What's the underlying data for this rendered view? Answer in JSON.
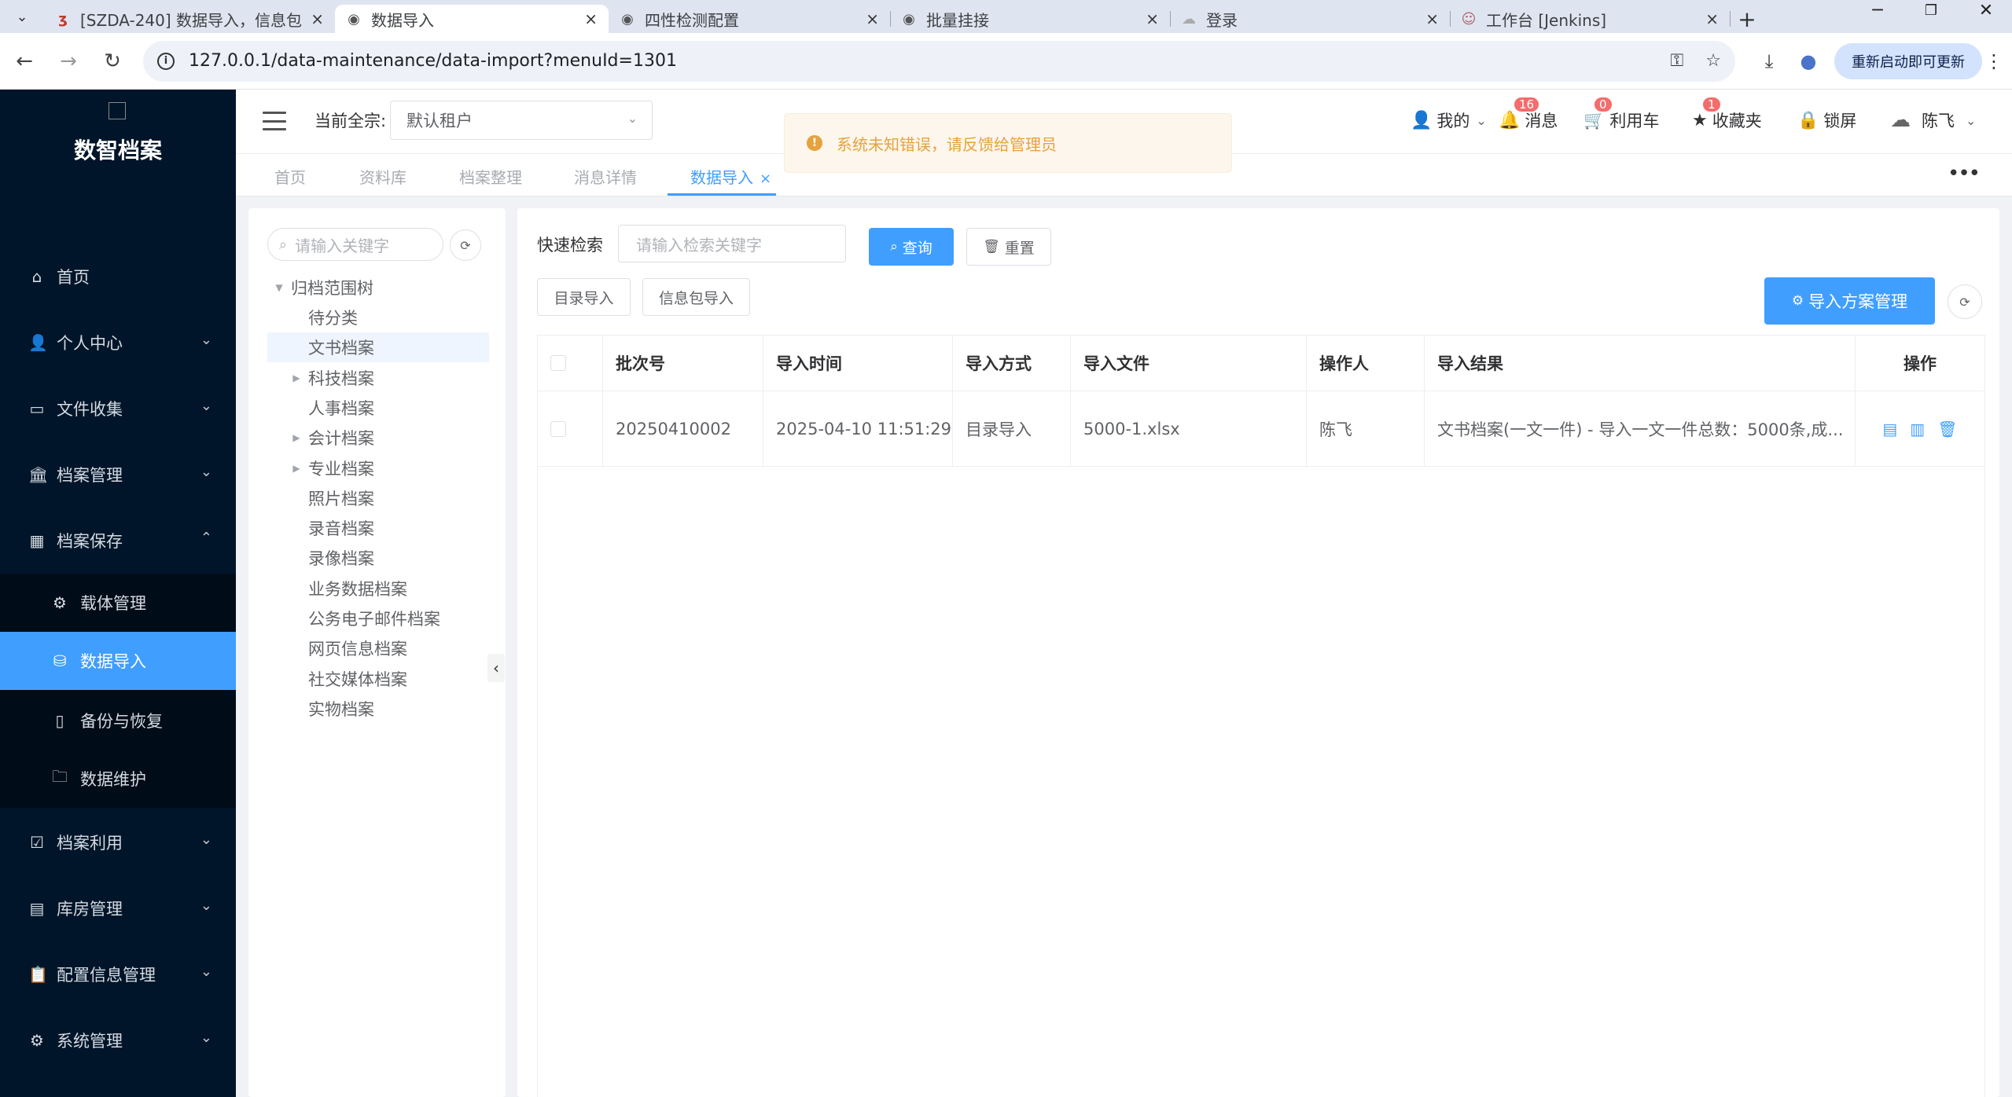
{
  "browser": {
    "tabs": [
      {
        "title": "[SZDA-240] 数据导入，信息包",
        "icon": "jira-icon",
        "active": false
      },
      {
        "title": "数据导入",
        "icon": "globe-icon",
        "active": true
      },
      {
        "title": "四性检测配置",
        "icon": "globe-icon",
        "active": false
      },
      {
        "title": "批量挂接",
        "icon": "globe-icon",
        "active": false
      },
      {
        "title": "登录",
        "icon": "cloud-icon",
        "active": false
      },
      {
        "title": "工作台 [Jenkins]",
        "icon": "jenkins-icon",
        "active": false
      }
    ],
    "url": "127.0.0.1/data-maintenance/data-import?menuId=1301",
    "update_label": "重新启动即可更新"
  },
  "sidebar": {
    "logo_title": "数智档案",
    "items": [
      {
        "label": "首页",
        "icon": "home-icon",
        "expandable": false
      },
      {
        "label": "个人中心",
        "icon": "user-icon",
        "expandable": true
      },
      {
        "label": "文件收集",
        "icon": "briefcase-icon",
        "expandable": true
      },
      {
        "label": "档案管理",
        "icon": "bank-icon",
        "expandable": true
      },
      {
        "label": "档案保存",
        "icon": "building-icon",
        "expandable": true,
        "expanded": true
      }
    ],
    "subitems": [
      {
        "label": "载体管理",
        "icon": "chip-icon"
      },
      {
        "label": "数据导入",
        "icon": "import-icon",
        "active": true
      },
      {
        "label": "备份与恢复",
        "icon": "backup-icon"
      },
      {
        "label": "数据维护",
        "icon": "folder-icon"
      }
    ],
    "items_after": [
      {
        "label": "档案利用",
        "icon": "checklist-icon"
      },
      {
        "label": "库房管理",
        "icon": "warehouse-icon"
      },
      {
        "label": "配置信息管理",
        "icon": "clipboard-icon"
      },
      {
        "label": "系统管理",
        "icon": "gear-icon"
      }
    ]
  },
  "header": {
    "tenant_label": "当前全宗:",
    "tenant_value": "默认租户",
    "mine": "我的",
    "messages": "消息",
    "messages_count": "16",
    "cart": "利用车",
    "cart_count": "0",
    "favorites": "收藏夹",
    "favorites_count": "1",
    "lock": "锁屏",
    "user": "陈飞"
  },
  "alert": {
    "text": "系统未知错误，请反馈给管理员"
  },
  "tags": [
    {
      "label": "首页"
    },
    {
      "label": "资料库"
    },
    {
      "label": "档案整理"
    },
    {
      "label": "消息详情"
    },
    {
      "label": "数据导入",
      "active": true
    }
  ],
  "tree": {
    "search_placeholder": "请输入关键字",
    "root": "归档范围树",
    "nodes": [
      {
        "label": "待分类",
        "has_children": false
      },
      {
        "label": "文书档案",
        "has_children": false,
        "selected": true
      },
      {
        "label": "科技档案",
        "has_children": true
      },
      {
        "label": "人事档案",
        "has_children": false
      },
      {
        "label": "会计档案",
        "has_children": true
      },
      {
        "label": "专业档案",
        "has_children": true
      },
      {
        "label": "照片档案",
        "has_children": false
      },
      {
        "label": "录音档案",
        "has_children": false
      },
      {
        "label": "录像档案",
        "has_children": false
      },
      {
        "label": "业务数据档案",
        "has_children": false
      },
      {
        "label": "公务电子邮件档案",
        "has_children": false
      },
      {
        "label": "网页信息档案",
        "has_children": false
      },
      {
        "label": "社交媒体档案",
        "has_children": false
      },
      {
        "label": "实物档案",
        "has_children": false
      }
    ]
  },
  "main": {
    "quick_search_label": "快速检索",
    "quick_search_placeholder": "请输入检索关键字",
    "query_button": "查询",
    "reset_button": "重置",
    "catalog_import_button": "目录导入",
    "package_import_button": "信息包导入",
    "scheme_button": "导入方案管理",
    "table": {
      "headers": [
        "批次号",
        "导入时间",
        "导入方式",
        "导入文件",
        "操作人",
        "导入结果",
        "操作"
      ],
      "rows": [
        {
          "batch": "20250410002",
          "time": "2025-04-10 11:51:29",
          "method": "目录导入",
          "file": "5000-1.xlsx",
          "operator": "陈飞",
          "result": "文书档案(一文一件) - 导入一文一件总数：5000条,成..."
        }
      ]
    }
  }
}
